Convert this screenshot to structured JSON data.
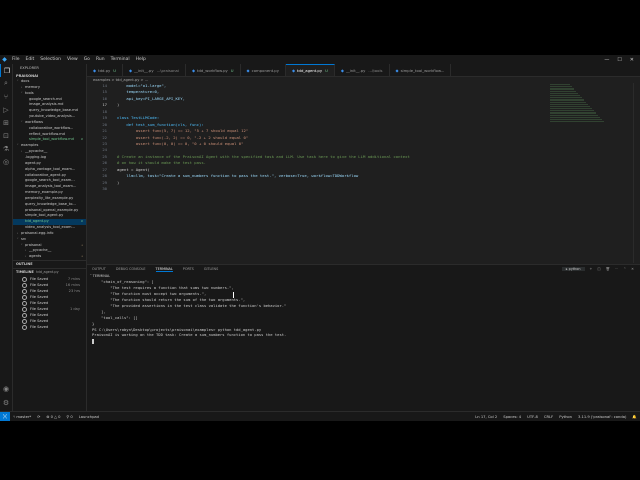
{
  "menu": {
    "items": [
      "File",
      "Edit",
      "Selection",
      "View",
      "Go",
      "Run",
      "Terminal",
      "Help"
    ],
    "search": ""
  },
  "explorer": {
    "title": "EXPLORER",
    "root": "PRAISONAI",
    "tree": [
      {
        "label": "docs",
        "indent": 1,
        "twisty": "˅",
        "badge": ""
      },
      {
        "label": "memory",
        "indent": 2,
        "twisty": "›",
        "badge": ""
      },
      {
        "label": "tools",
        "indent": 2,
        "twisty": "˅",
        "badge": ""
      },
      {
        "label": "google_search.md",
        "indent": 3,
        "twisty": "",
        "badge": ""
      },
      {
        "label": "image_analysis.md",
        "indent": 3,
        "twisty": "",
        "badge": ""
      },
      {
        "label": "query_knowledge_base.md",
        "indent": 3,
        "twisty": "",
        "badge": ""
      },
      {
        "label": "youtube_video_analysis...",
        "indent": 3,
        "twisty": "",
        "badge": ""
      },
      {
        "label": "workflows",
        "indent": 2,
        "twisty": "˅",
        "badge": ""
      },
      {
        "label": "collaborative_workflow...",
        "indent": 3,
        "twisty": "",
        "badge": ""
      },
      {
        "label": "reflect_workflow.md",
        "indent": 3,
        "twisty": "",
        "badge": ""
      },
      {
        "label": "simple_tool_workflow.md",
        "indent": 3,
        "twisty": "",
        "badge": "U"
      },
      {
        "label": "examples",
        "indent": 1,
        "twisty": "˅",
        "badge": ""
      },
      {
        "label": "__pycache__",
        "indent": 2,
        "twisty": "›",
        "badge": ""
      },
      {
        "label": ".logging.log",
        "indent": 2,
        "twisty": "",
        "badge": ""
      },
      {
        "label": "agent.py",
        "indent": 2,
        "twisty": "",
        "badge": ""
      },
      {
        "label": "alpha_vantage_tool_exam...",
        "indent": 2,
        "twisty": "",
        "badge": ""
      },
      {
        "label": "collaborative_agent.py",
        "indent": 2,
        "twisty": "",
        "badge": ""
      },
      {
        "label": "google_search_tool_exam...",
        "indent": 2,
        "twisty": "",
        "badge": ""
      },
      {
        "label": "image_analysis_tool_exam...",
        "indent": 2,
        "twisty": "",
        "badge": ""
      },
      {
        "label": "memory_example.py",
        "indent": 2,
        "twisty": "",
        "badge": ""
      },
      {
        "label": "perplexity_lite_example.py",
        "indent": 2,
        "twisty": "",
        "badge": ""
      },
      {
        "label": "query_knowledge_base_to...",
        "indent": 2,
        "twisty": "",
        "badge": ""
      },
      {
        "label": "praisonai_openai_example.py",
        "indent": 2,
        "twisty": "",
        "badge": ""
      },
      {
        "label": "simple_tool_agent.py",
        "indent": 2,
        "twisty": "",
        "badge": ""
      },
      {
        "label": "tdd_agent.py",
        "indent": 2,
        "twisty": "",
        "badge": "U",
        "selected": true
      },
      {
        "label": "video_analysis_tool_exam...",
        "indent": 2,
        "twisty": "",
        "badge": ""
      },
      {
        "label": "praisonai.egg-info",
        "indent": 1,
        "twisty": "›",
        "badge": ""
      },
      {
        "label": "src",
        "indent": 1,
        "twisty": "˅",
        "badge": ""
      },
      {
        "label": "praisonai",
        "indent": 2,
        "twisty": "˅",
        "badge": "•"
      },
      {
        "label": "__pycache__",
        "indent": 3,
        "twisty": "›",
        "badge": ""
      },
      {
        "label": "agents",
        "indent": 3,
        "twisty": "›",
        "badge": "•"
      }
    ],
    "outline_label": "OUTLINE",
    "timeline_label": "TIMELINE",
    "timeline_file": "tdd_agent.py",
    "timeline": [
      {
        "label": "File Saved",
        "ago": "7 mins"
      },
      {
        "label": "File Saved",
        "ago": "16 mins"
      },
      {
        "label": "File Saved",
        "ago": "23 hrs"
      },
      {
        "label": "File Saved",
        "ago": ""
      },
      {
        "label": "File Saved",
        "ago": ""
      },
      {
        "label": "File Saved",
        "ago": "1 day"
      },
      {
        "label": "File Saved",
        "ago": ""
      },
      {
        "label": "File Saved",
        "ago": ""
      },
      {
        "label": "File Saved",
        "ago": ""
      }
    ]
  },
  "tabs": [
    {
      "label": "tdd.py",
      "status": "U"
    },
    {
      "label": "__init__.py",
      "status": "...\\praisonai"
    },
    {
      "label": "tdd_workflow.py",
      "status": "U"
    },
    {
      "label": "component.py",
      "status": ""
    },
    {
      "label": "tdd_agent.py",
      "status": "U",
      "active": true
    },
    {
      "label": "__init__.py",
      "status": "...\\tools"
    },
    {
      "label": "simple_tool_workflow...",
      "status": ""
    }
  ],
  "breadcrumb": "examples > tdd_agent.py > ...",
  "code": [
    {
      "n": "14",
      "t": "    model=\"o1-large\","
    },
    {
      "n": "15",
      "t": "    temperature=0,"
    },
    {
      "n": "16",
      "t": "    api_key=PI_LARGE_API_KEY,"
    },
    {
      "n": "17",
      "t": ")",
      "cur": true
    },
    {
      "n": "18",
      "t": ""
    },
    {
      "n": "19",
      "t": "class TestLLMCode:"
    },
    {
      "n": "20",
      "t": "    def test_sum_function(cls, func):"
    },
    {
      "n": "21",
      "t": "        assert func(5, 7) == 12, \"5 + 7 should equal 12\""
    },
    {
      "n": "22",
      "t": "        assert func(-2, 2) == 0, \"-2 + 2 should equal 0\""
    },
    {
      "n": "23",
      "t": "        assert func(0, 0) == 0, \"0 + 0 should equal 0\""
    },
    {
      "n": "24",
      "t": ""
    },
    {
      "n": "25",
      "t": "# Create an instance of the PraisonAI Agent with the specified task and LLM. Use task here to give the LLM additional context"
    },
    {
      "n": "26",
      "t": "# on how it should make the test pass."
    },
    {
      "n": "27",
      "t": "agent = Agent("
    },
    {
      "n": "28",
      "t": "    llm=llm, task=\"Create a sum_numbers function to pass the test.\", verbose=True, workflow=TDDWorkflow"
    },
    {
      "n": "29",
      "t": ")"
    },
    {
      "n": "30",
      "t": ""
    }
  ],
  "panel": {
    "tabs": [
      "OUTPUT",
      "DEBUG CONSOLE",
      "TERMINAL",
      "PORTS",
      "GITLENS"
    ],
    "active": "TERMINAL",
    "terminal_label": "TERMINAL",
    "shell": "python",
    "lines": [
      "    \"chain_of_reasoning\": [",
      "        \"The test requires a function that sums two numbers.\",",
      "        \"The function must accept two arguments.\",",
      "        \"The function should return the sum of the two arguments.\",",
      "        \"The provided assertions in the test class validate the function's behavior.\"",
      "    ],",
      "    \"tool_calls\": []",
      "}",
      "PS C:\\Users\\robyn\\Desktop\\projects\\praisonai\\examples> python tdd_agent.py",
      "PraisonAI is working on the TDD task: Create a sum_numbers function to pass the test."
    ]
  },
  "status": {
    "branch": "master*",
    "sync": "⟳",
    "errors": "⊗ 0 △ 0",
    "ports": "⚲ 0",
    "launchpad": "Launchpad",
    "position": "Ln 17, Col 2",
    "spaces": "Spaces: 4",
    "encoding": "UTF-8",
    "eol": "CRLF",
    "language": "Python",
    "interpreter": "3.11.9 ('praisonai': conda)"
  }
}
